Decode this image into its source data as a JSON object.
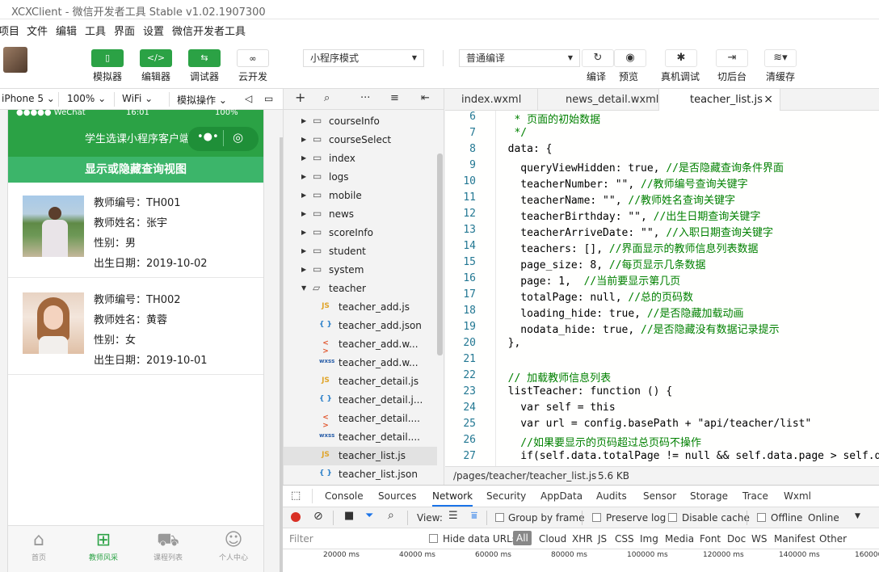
{
  "window_title": "XCXClient - 微信开发者工具 Stable v1.02.1907300",
  "menu": [
    "项目",
    "文件",
    "编辑",
    "工具",
    "界面",
    "设置",
    "微信开发者工具"
  ],
  "toolbar": {
    "mode_buttons": [
      {
        "icon": "simulator-icon",
        "label": "模拟器"
      },
      {
        "icon": "editor-icon",
        "label": "编辑器"
      },
      {
        "icon": "debugger-icon",
        "label": "调试器"
      },
      {
        "icon": "cloud-icon",
        "label": "云开发"
      }
    ],
    "mode_select": "小程序模式",
    "compile_select": "普通编译",
    "actions": [
      {
        "icon": "refresh-icon",
        "label": "编译"
      },
      {
        "icon": "eye-icon",
        "label": "预览"
      },
      {
        "icon": "bug-icon",
        "label": "真机调试"
      },
      {
        "icon": "background-icon",
        "label": "切后台"
      },
      {
        "icon": "layers-icon",
        "label": "清缓存"
      }
    ]
  },
  "device_bar": {
    "device": "iPhone 5",
    "zoom": "100%",
    "network": "WiFi",
    "sim_action": "模拟操作"
  },
  "phone": {
    "status_carrier": "●●●●● WeChat",
    "status_time": "16:01",
    "status_battery": "100%",
    "nav_title": "学生选课小程序客户端",
    "query_toggle": "显示或隐藏查询视图",
    "teachers": [
      {
        "number": "教师编号：TH001",
        "name": "教师姓名：张宇",
        "gender": "性别：男",
        "birthday": "出生日期：2019-10-02"
      },
      {
        "number": "教师编号：TH002",
        "name": "教师姓名：黄蓉",
        "gender": "性别：女",
        "birthday": "出生日期：2019-10-01"
      }
    ],
    "tabs": [
      {
        "icon": "home-icon",
        "label": "首页"
      },
      {
        "icon": "grid-icon",
        "label": "教师风采"
      },
      {
        "icon": "cart-icon",
        "label": "课程列表"
      },
      {
        "icon": "user-icon",
        "label": "个人中心"
      }
    ]
  },
  "explorer": {
    "folders": [
      "courseInfo",
      "courseSelect",
      "index",
      "logs",
      "mobile",
      "news",
      "scoreInfo",
      "student",
      "system",
      "teacher"
    ],
    "files": [
      {
        "type": "JS",
        "name": "teacher_add.js"
      },
      {
        "type": "{ }",
        "name": "teacher_add.json"
      },
      {
        "type": "< >",
        "name": "teacher_add.w..."
      },
      {
        "type": "wxss",
        "name": "teacher_add.w..."
      },
      {
        "type": "JS",
        "name": "teacher_detail.js"
      },
      {
        "type": "{ }",
        "name": "teacher_detail.j..."
      },
      {
        "type": "< >",
        "name": "teacher_detail...."
      },
      {
        "type": "wxss",
        "name": "teacher_detail...."
      },
      {
        "type": "JS",
        "name": "teacher_list.js"
      },
      {
        "type": "{ }",
        "name": "teacher_list.json"
      }
    ]
  },
  "editor": {
    "tabs": [
      "index.wxml",
      "news_detail.wxml",
      "teacher_list.js"
    ],
    "lines": [
      {
        "n": "6",
        "t": "   * 页面的初始数据"
      },
      {
        "n": "7",
        "t": "   */"
      },
      {
        "n": "8",
        "t": "  data: {"
      },
      {
        "n": "9",
        "t": "    queryViewHidden: true, //是否隐藏查询条件界面"
      },
      {
        "n": "10",
        "t": "    teacherNumber: \"\", //教师编号查询关键字"
      },
      {
        "n": "11",
        "t": "    teacherName: \"\", //教师姓名查询关键字"
      },
      {
        "n": "12",
        "t": "    teacherBirthday: \"\", //出生日期查询关键字"
      },
      {
        "n": "13",
        "t": "    teacherArriveDate: \"\", //入职日期查询关键字"
      },
      {
        "n": "14",
        "t": "    teachers: [], //界面显示的教师信息列表数据"
      },
      {
        "n": "15",
        "t": "    page_size: 8, //每页显示几条数据"
      },
      {
        "n": "16",
        "t": "    page: 1,  //当前要显示第几页"
      },
      {
        "n": "17",
        "t": "    totalPage: null, //总的页码数"
      },
      {
        "n": "18",
        "t": "    loading_hide: true, //是否隐藏加载动画"
      },
      {
        "n": "19",
        "t": "    nodata_hide: true, //是否隐藏没有数据记录提示"
      },
      {
        "n": "20",
        "t": "  },"
      },
      {
        "n": "21",
        "t": ""
      },
      {
        "n": "22",
        "t": "  // 加载教师信息列表"
      },
      {
        "n": "23",
        "t": "  listTeacher: function () {"
      },
      {
        "n": "24",
        "t": "    var self = this"
      },
      {
        "n": "25",
        "t": "    var url = config.basePath + \"api/teacher/list\""
      },
      {
        "n": "26",
        "t": "    //如果要显示的页码超过总页码不操作"
      },
      {
        "n": "27",
        "t": "    if(self.data.totalPage != null && self.data.page > self.dat"
      }
    ],
    "status_path": "/pages/teacher/teacher_list.js",
    "status_size": "5.6 KB"
  },
  "devtools": {
    "tabs": [
      "Console",
      "Sources",
      "Network",
      "Security",
      "AppData",
      "Audits",
      "Sensor",
      "Storage",
      "Trace",
      "Wxml"
    ],
    "active_tab": "Network",
    "view_label": "View:",
    "group_by_frame": "Group by frame",
    "preserve_log": "Preserve log",
    "disable_cache": "Disable cache",
    "offline": "Offline",
    "online": "Online",
    "filter_placeholder": "Filter",
    "hide_data_urls": "Hide data URLs",
    "types": [
      "All",
      "Cloud",
      "XHR",
      "JS",
      "CSS",
      "Img",
      "Media",
      "Font",
      "Doc",
      "WS",
      "Manifest",
      "Other"
    ],
    "timeline": [
      "20000 ms",
      "40000 ms",
      "60000 ms",
      "80000 ms",
      "100000 ms",
      "120000 ms",
      "140000 ms",
      "160000"
    ]
  }
}
